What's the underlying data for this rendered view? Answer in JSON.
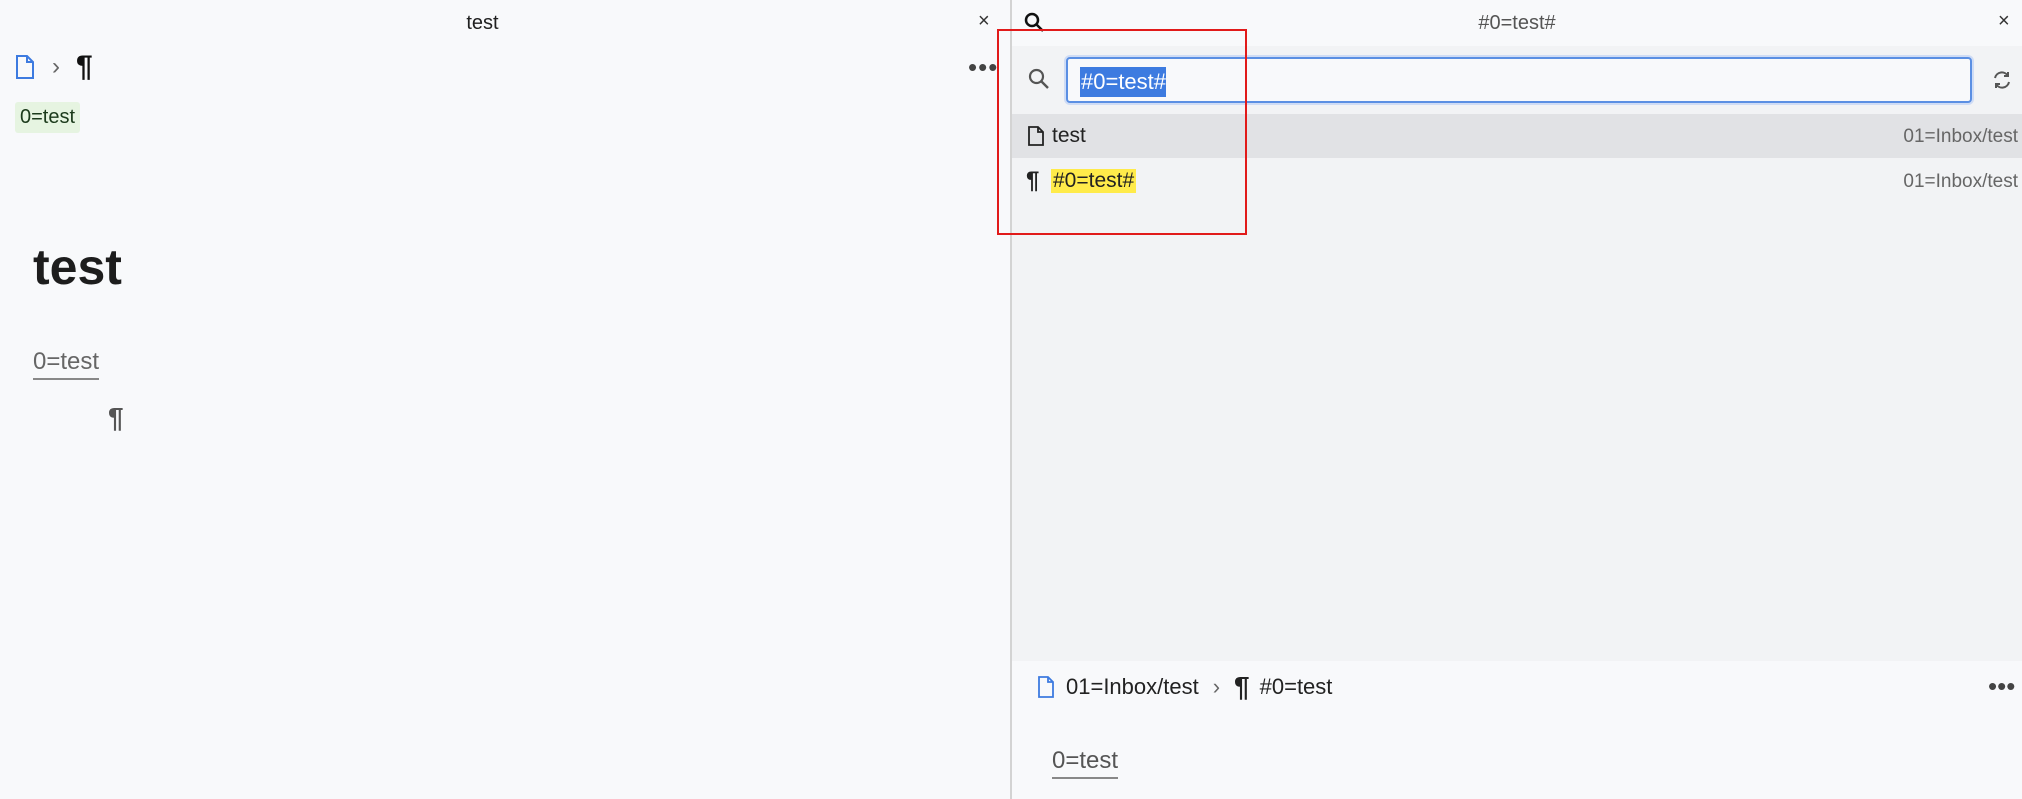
{
  "left": {
    "tab_title": "test",
    "close_glyph": "×",
    "breadcrumb": {
      "sep": "›",
      "pilcrow": "¶"
    },
    "more_glyph": "•••",
    "tag": "0=test",
    "doc_title": "test",
    "doc_link": "0=test",
    "doc_pilcrow": "¶"
  },
  "right": {
    "header_title": "#0=test#",
    "close_glyph": "×",
    "search": {
      "value": "#0=test#"
    },
    "results": [
      {
        "icon": "file-icon",
        "label": "test",
        "path": "01=Inbox/test"
      },
      {
        "icon": "pilcrow-icon",
        "label": "#0=test#",
        "path": "01=Inbox/test"
      }
    ],
    "result_pilcrow": "¶",
    "preview": {
      "breadcrumb_path": "01=Inbox/test",
      "sep": "›",
      "pilcrow": "¶",
      "block_label": "#0=test",
      "more_glyph": "•••",
      "link": "0=test"
    }
  },
  "colors": {
    "accent": "#3d7be0",
    "highlight": "#ffeb4a",
    "tag_bg": "#e6f4e1",
    "annotation_red": "#e11a1a"
  }
}
